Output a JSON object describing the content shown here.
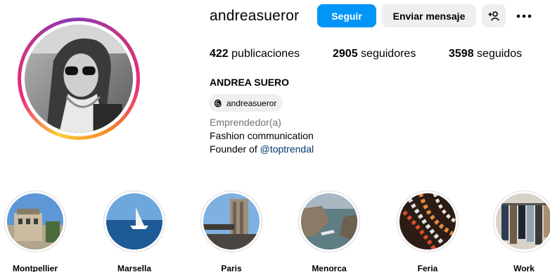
{
  "profile": {
    "username": "andreasueror",
    "full_name": "ANDREA SUERO",
    "threads_handle": "andreasueror",
    "category": "Emprendedor(a)",
    "bio_line1": "Fashion communication",
    "bio_line2_prefix": "Founder of ",
    "bio_link": "@toptrendal"
  },
  "actions": {
    "follow_label": "Seguir",
    "message_label": "Enviar mensaje",
    "suggest_icon": "add-person-icon",
    "more_icon": "more-options-icon"
  },
  "stats": {
    "posts_count": "422",
    "posts_label": " publicaciones",
    "followers_count": "2905",
    "followers_label": " seguidores",
    "following_count": "3598",
    "following_label": " seguidos"
  },
  "highlights": [
    {
      "label": "Montpellier"
    },
    {
      "label": "Marsella"
    },
    {
      "label": "Paris"
    },
    {
      "label": "Menorca"
    },
    {
      "label": "Feria"
    },
    {
      "label": "Work"
    }
  ],
  "colors": {
    "accent": "#0095f6",
    "secondary_button": "#efefef",
    "link": "#00376b",
    "muted_text": "#737373"
  }
}
